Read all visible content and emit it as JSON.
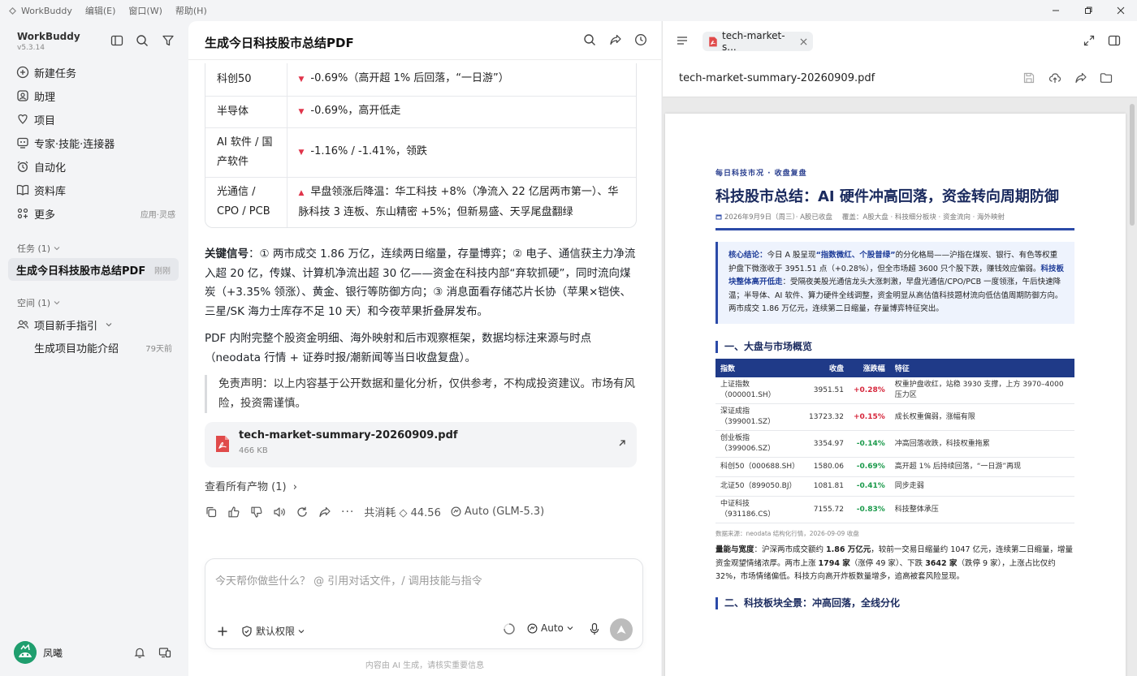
{
  "titlebar": {
    "app": "WorkBuddy",
    "menus": [
      "编辑(E)",
      "窗口(W)",
      "帮助(H)"
    ]
  },
  "sidebar": {
    "app_name": "WorkBuddy",
    "version": "v5.3.14",
    "nav": [
      {
        "label": "新建任务",
        "icon": "plus-circle-icon"
      },
      {
        "label": "助理",
        "icon": "assistant-icon"
      },
      {
        "label": "项目",
        "icon": "project-icon"
      },
      {
        "label": "专家·技能·连接器",
        "icon": "expert-icon"
      },
      {
        "label": "自动化",
        "icon": "alarm-icon"
      },
      {
        "label": "资料库",
        "icon": "book-icon"
      },
      {
        "label": "更多",
        "icon": "grid-icon",
        "aside": "应用·灵感"
      }
    ],
    "tasks_header": "任务 (1)",
    "tasks": [
      {
        "label": "生成今日科技股市总结PDF",
        "time": "刚刚"
      }
    ],
    "spaces_header": "空间 (1)",
    "spaces": [
      {
        "label": "项目新手指引"
      }
    ],
    "space_children": [
      {
        "label": "生成项目功能介绍",
        "time": "79天前"
      }
    ],
    "user": "凤曦"
  },
  "chat": {
    "title": "生成今日科技股市总结PDF",
    "market_rows": [
      {
        "name": "科创50",
        "dir": "down",
        "text": "-0.69%（高开超 1% 后回落，“一日游”）"
      },
      {
        "name": "半导体",
        "dir": "down",
        "text": "-0.69%，高开低走"
      },
      {
        "name": "AI 软件 / 国产软件",
        "dir": "down",
        "text": "-1.16% / -1.41%，领跌"
      },
      {
        "name": "光通信 / CPO / PCB",
        "dir": "up",
        "text": "早盘领涨后降温：华工科技 +8%（净流入 22 亿居两市第一）、华脉科技 3 连板、东山精密 +5%；但新易盛、天孚尾盘翻绿"
      }
    ],
    "signal_label": "关键信号",
    "signal_text": "：① 两市成交 1.86 万亿，连续两日缩量，存量博弈；② 电子、通信获主力净流入超 20 亿，传媒、计算机净流出超 30 亿——资金在科技内部“弃软抓硬”，同时流向煤炭（+3.35% 领涨）、黄金、银行等防御方向；③ 消息面看存储芯片长协（苹果×铠侠、三星/SK 海力士库存不足 10 天）和今夜苹果折叠屏发布。",
    "pdf_note": "PDF 内附完整个股资金明细、海外映射和后市观察框架，数据均标注来源与时点（neodata 行情 + 证券时报/潮新闻等当日收盘复盘）。",
    "disclaimer": "免责声明：以上内容基于公开数据和量化分析，仅供参考，不构成投资建议。市场有风险，投资需谨慎。",
    "file": {
      "name": "tech-market-summary-20260909.pdf",
      "size": "466 KB"
    },
    "view_all": "查看所有产物 (1)",
    "usage": "共消耗 ◇ 44.56",
    "model": "Auto (GLM-5.3)",
    "composer_placeholder": "今天帮你做些什么？ @ 引用对话文件，/ 调用技能与指令",
    "permission": "默认权限",
    "auto": "Auto",
    "footnote": "内容由 AI 生成，请核实重要信息"
  },
  "viewer": {
    "tab": "tech-market-s...",
    "filename": "tech-market-summary-20260909.pdf",
    "pdf": {
      "kicker": "每日科技市况 · 收盘复盘",
      "title": "科技股市总结：AI 硬件冲高回落，资金转向周期防御",
      "meta_date": "2026年9月9日（周三）· A股已收盘",
      "meta_scope": "覆盖：A股大盘 · 科技细分板块 · 资金流向 · 海外映射",
      "core_label": "核心结论：",
      "core_1": "今日 A 股呈现",
      "core_hl1": "“指数微红、个股普绿”",
      "core_2": "的分化格局——沪指在煤炭、银行、有色等权重护盘下微涨收于 3951.51 点（+0.28%），但全市场超 3600 只个股下跌，赚钱效应偏弱。",
      "core_hl2": "科技板块整体高开低走",
      "core_3": "：受隔夜美股光通信龙头大涨刺激，早盘光通信/CPO/PCB 一度领涨，午后快速降温；半导体、AI 软件、算力硬件全线调整，资金明显从高估值科技题材流向低估值周期防御方向。两市成交 1.86 万亿元，连续第二日缩量，存量博弈特征突出。",
      "h2_1": "一、大盘与市场概览",
      "table_headers": [
        "指数",
        "收盘",
        "涨跌幅",
        "特征"
      ],
      "table_rows": [
        {
          "name": "上证指数（000001.SH）",
          "close": "3951.51",
          "chg": "+0.28%",
          "dir": "up",
          "note": "权重护盘收红，站稳 3930 支撑，上方 3970–4000 压力区"
        },
        {
          "name": "深证成指（399001.SZ）",
          "close": "13723.32",
          "chg": "+0.15%",
          "dir": "up",
          "note": "成长权重偏弱，涨幅有限"
        },
        {
          "name": "创业板指（399006.SZ）",
          "close": "3354.97",
          "chg": "-0.14%",
          "dir": "dn",
          "note": "冲高回落收跌，科技权重拖累"
        },
        {
          "name": "科创50（000688.SH）",
          "close": "1580.06",
          "chg": "-0.69%",
          "dir": "dn",
          "note": "高开超 1% 后持续回落，“一日游”再现"
        },
        {
          "name": "北证50（899050.BJ）",
          "close": "1081.81",
          "chg": "-0.41%",
          "dir": "dn",
          "note": "同步走弱"
        },
        {
          "name": "中证科技（931186.CS）",
          "close": "7155.72",
          "chg": "-0.83%",
          "dir": "dn",
          "note": "科技整体承压"
        }
      ],
      "source": "数据来源：neodata 结构化行情，2026-09-09 收盘",
      "vol_label": "量能与宽度",
      "vol_1": "：沪深两市成交额约 ",
      "vol_b1": "1.86 万亿元",
      "vol_2": "，较前一交易日缩量约 1047 亿元，连续第二日缩量，增量资金观望情绪浓厚。两市上涨 ",
      "vol_b2": "1794 家",
      "vol_3": "（涨停 49 家）、下跌 ",
      "vol_b3": "3642 家",
      "vol_4": "（跌停 9 家），上涨占比仅约 32%，市场情绪偏低。科技方向高开炸板数量增多，追高被套风险显现。",
      "h2_2": "二、科技板块全景：冲高回落，全线分化"
    }
  },
  "colors": {
    "accent": "#2b4aa8",
    "up": "#d6263b",
    "down": "#1b9a4b",
    "pdf_red": "#e04a4a"
  }
}
